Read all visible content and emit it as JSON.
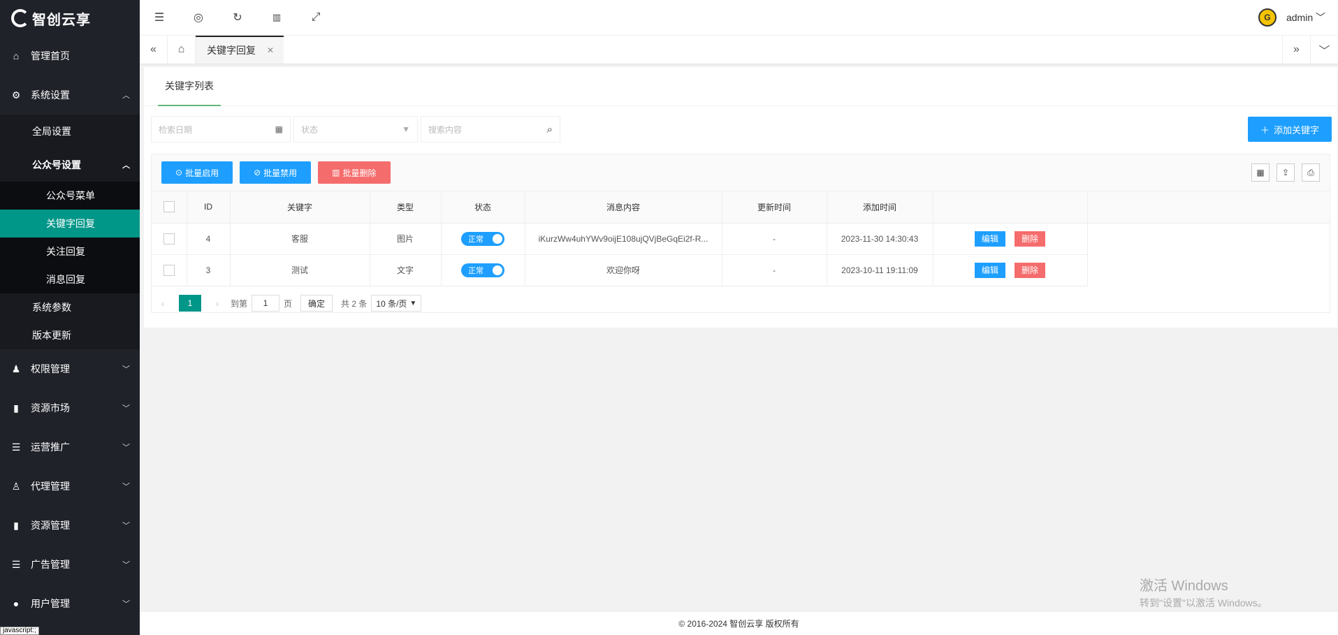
{
  "brand": {
    "name": "智创云享"
  },
  "sidebar": {
    "home": "管理首页",
    "system": "系统设置",
    "global": "全局设置",
    "wechat": "公众号设置",
    "wechat_items": [
      "公众号菜单",
      "关键字回复",
      "关注回复",
      "消息回复"
    ],
    "sys_params": "系统参数",
    "version": "版本更新",
    "groups": [
      "权限管理",
      "资源市场",
      "运营推广",
      "代理管理",
      "资源管理",
      "广告管理",
      "用户管理"
    ],
    "tooltip": "javascript:;"
  },
  "topbar": {
    "user": "admin"
  },
  "tabbar": {
    "active_tab": "关键字回复"
  },
  "card": {
    "tab": "关键字列表"
  },
  "filters": {
    "date_placeholder": "检索日期",
    "status_placeholder": "状态",
    "search_placeholder": "搜索内容",
    "add_label": "添加关键字"
  },
  "toolbar": {
    "enable": "批量启用",
    "disable": "批量禁用",
    "delete": "批量删除"
  },
  "table": {
    "columns": [
      "ID",
      "关键字",
      "类型",
      "状态",
      "消息内容",
      "更新时间",
      "添加时间"
    ],
    "rows": [
      {
        "id": "4",
        "keyword": "客服",
        "type": "图片",
        "status": "正常",
        "content": "iKurzWw4uhYWv9oijE108ujQVjBeGqEi2f-R...",
        "updated": "-",
        "added": "2023-11-30 14:30:43"
      },
      {
        "id": "3",
        "keyword": "测试",
        "type": "文字",
        "status": "正常",
        "content": "欢迎你呀",
        "updated": "-",
        "added": "2023-10-11 19:11:09"
      }
    ],
    "edit": "编辑",
    "del": "删除"
  },
  "pager": {
    "current": "1",
    "goto": "到第",
    "page_input": "1",
    "page_unit": "页",
    "confirm": "确定",
    "total": "共 2 条",
    "per_page": "10 条/页"
  },
  "footer": {
    "copyright": "© 2016-2024 智创云享 版权所有"
  },
  "watermark": {
    "line1": "激活 Windows",
    "line2": "转到\"设置\"以激活 Windows。"
  }
}
